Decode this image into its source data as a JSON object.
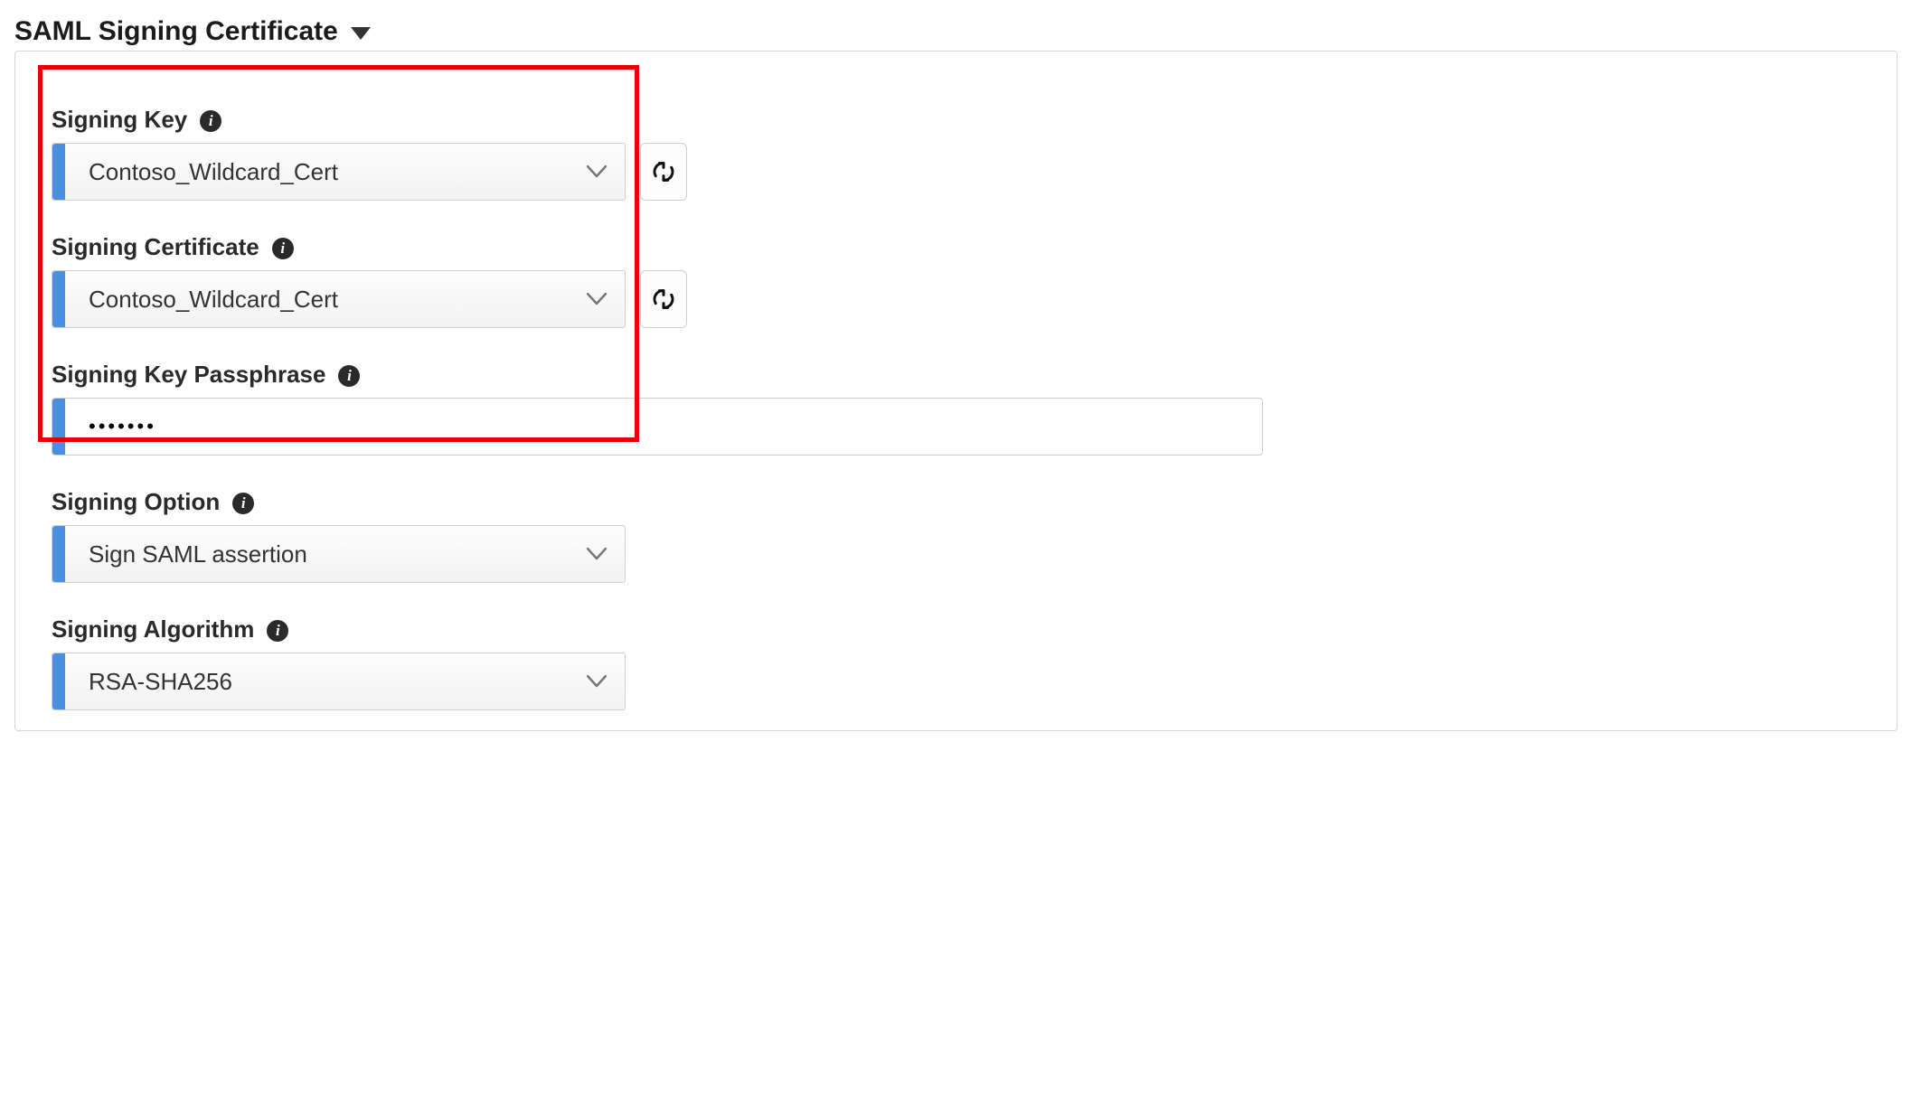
{
  "section": {
    "title": "SAML Signing Certificate"
  },
  "fields": {
    "signing_key": {
      "label": "Signing Key",
      "value": "Contoso_Wildcard_Cert"
    },
    "signing_certificate": {
      "label": "Signing Certificate",
      "value": "Contoso_Wildcard_Cert"
    },
    "signing_key_passphrase": {
      "label": "Signing Key Passphrase",
      "masked_value": "•••••••"
    },
    "signing_option": {
      "label": "Signing Option",
      "value": "Sign SAML assertion"
    },
    "signing_algorithm": {
      "label": "Signing Algorithm",
      "value": "RSA-SHA256"
    }
  }
}
